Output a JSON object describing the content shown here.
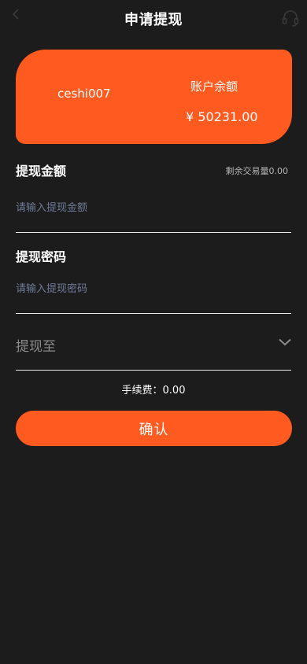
{
  "header": {
    "back_icon": "chevron-left-icon",
    "title": "申请提现",
    "support_icon": "headset-icon"
  },
  "card": {
    "username": "ceshi007",
    "balance_label": "账户余额",
    "balance_value": "¥ 50231.00",
    "color": "#ff5a1f"
  },
  "amount": {
    "label": "提现金额",
    "remaining": "剩余交易量0.00",
    "placeholder": "请输入提现金额"
  },
  "password": {
    "label": "提现密码",
    "placeholder": "请输入提现密码"
  },
  "withdraw_to": {
    "label": "提现至",
    "icon": "chevron-down-icon"
  },
  "fee_text": "手续费：0.00",
  "confirm_label": "确认"
}
